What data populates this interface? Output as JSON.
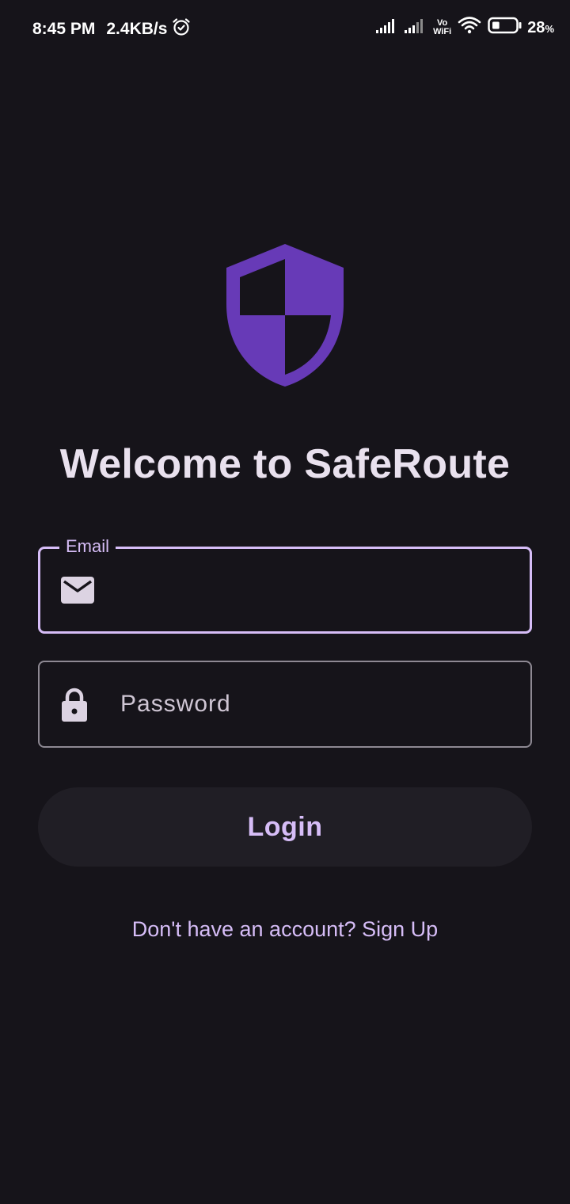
{
  "status_bar": {
    "time": "8:45 PM",
    "net_speed": "2.4KB/s",
    "alarm_icon": "alarm-icon",
    "vowifi_top": "Vo",
    "vowifi_bottom": "WiFi",
    "battery_level": 28,
    "battery_label": "28",
    "battery_pct_sign": "%"
  },
  "logo": {
    "icon": "shield-icon",
    "color": "#673ab7"
  },
  "title": "Welcome to SafeRoute",
  "email": {
    "label": "Email",
    "value": "",
    "placeholder": "",
    "icon": "mail-icon"
  },
  "password": {
    "placeholder": "Password",
    "value": "",
    "icon": "lock-icon"
  },
  "login_button": "Login",
  "signup_link": "Don't have an account? Sign Up",
  "colors": {
    "background": "#16141a",
    "accent": "#d6bdf7",
    "text": "#e9e1ee"
  }
}
